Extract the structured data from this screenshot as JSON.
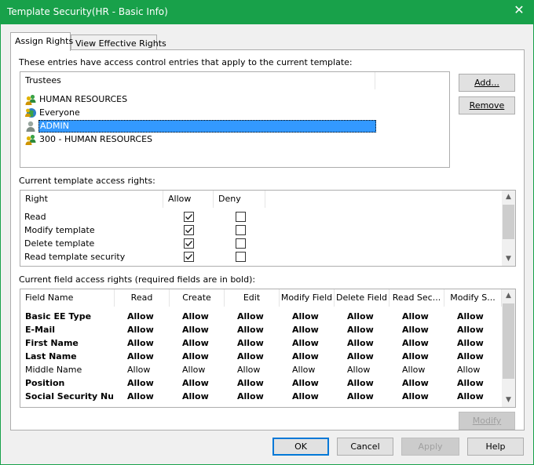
{
  "window": {
    "title": "Template Security(HR - Basic Info)",
    "close_glyph": "✕"
  },
  "tabs": [
    {
      "label": "Assign Rights",
      "active": true
    },
    {
      "label": "View Effective Rights",
      "active": false
    }
  ],
  "trustees_section": {
    "label": "These entries have access control entries that apply to the current template:",
    "column_header": "Trustees",
    "items": [
      {
        "name": "HUMAN RESOURCES",
        "icon": "group-icon",
        "selected": false
      },
      {
        "name": "Everyone",
        "icon": "everyone-icon",
        "selected": false
      },
      {
        "name": "ADMIN",
        "icon": "user-icon",
        "selected": true
      },
      {
        "name": "300 - HUMAN RESOURCES",
        "icon": "group-icon",
        "selected": false
      }
    ],
    "add_label": "Add...",
    "remove_label": "Remove"
  },
  "template_rights": {
    "label": "Current template access rights:",
    "headers": {
      "right": "Right",
      "allow": "Allow",
      "deny": "Deny"
    },
    "rows": [
      {
        "right": "Read",
        "allow": true,
        "deny": false
      },
      {
        "right": "Modify template",
        "allow": true,
        "deny": false
      },
      {
        "right": "Delete template",
        "allow": true,
        "deny": false
      },
      {
        "right": "Read template security",
        "allow": true,
        "deny": false
      }
    ]
  },
  "field_rights": {
    "label": "Current field access rights (required fields are in bold):",
    "headers": [
      "Field Name",
      "Read",
      "Create",
      "Edit",
      "Modify Field",
      "Delete Field",
      "Read Sec...",
      "Modify S..."
    ],
    "rows": [
      {
        "name": "Basic EE Type",
        "bold": true,
        "values": [
          "Allow",
          "Allow",
          "Allow",
          "Allow",
          "Allow",
          "Allow",
          "Allow"
        ]
      },
      {
        "name": "E-Mail",
        "bold": true,
        "values": [
          "Allow",
          "Allow",
          "Allow",
          "Allow",
          "Allow",
          "Allow",
          "Allow"
        ]
      },
      {
        "name": "First Name",
        "bold": true,
        "values": [
          "Allow",
          "Allow",
          "Allow",
          "Allow",
          "Allow",
          "Allow",
          "Allow"
        ]
      },
      {
        "name": "Last Name",
        "bold": true,
        "values": [
          "Allow",
          "Allow",
          "Allow",
          "Allow",
          "Allow",
          "Allow",
          "Allow"
        ]
      },
      {
        "name": "Middle Name",
        "bold": false,
        "values": [
          "Allow",
          "Allow",
          "Allow",
          "Allow",
          "Allow",
          "Allow",
          "Allow"
        ]
      },
      {
        "name": "Position",
        "bold": true,
        "values": [
          "Allow",
          "Allow",
          "Allow",
          "Allow",
          "Allow",
          "Allow",
          "Allow"
        ]
      },
      {
        "name": "Social Security Nu...",
        "bold": true,
        "values": [
          "Allow",
          "Allow",
          "Allow",
          "Allow",
          "Allow",
          "Allow",
          "Allow"
        ]
      }
    ],
    "modify_label": "Modify"
  },
  "footer": {
    "ok": "OK",
    "cancel": "Cancel",
    "apply": "Apply",
    "help": "Help"
  },
  "colors": {
    "titlebar": "#18a14a",
    "selection": "#3399ff",
    "default_border": "#0078d7"
  }
}
